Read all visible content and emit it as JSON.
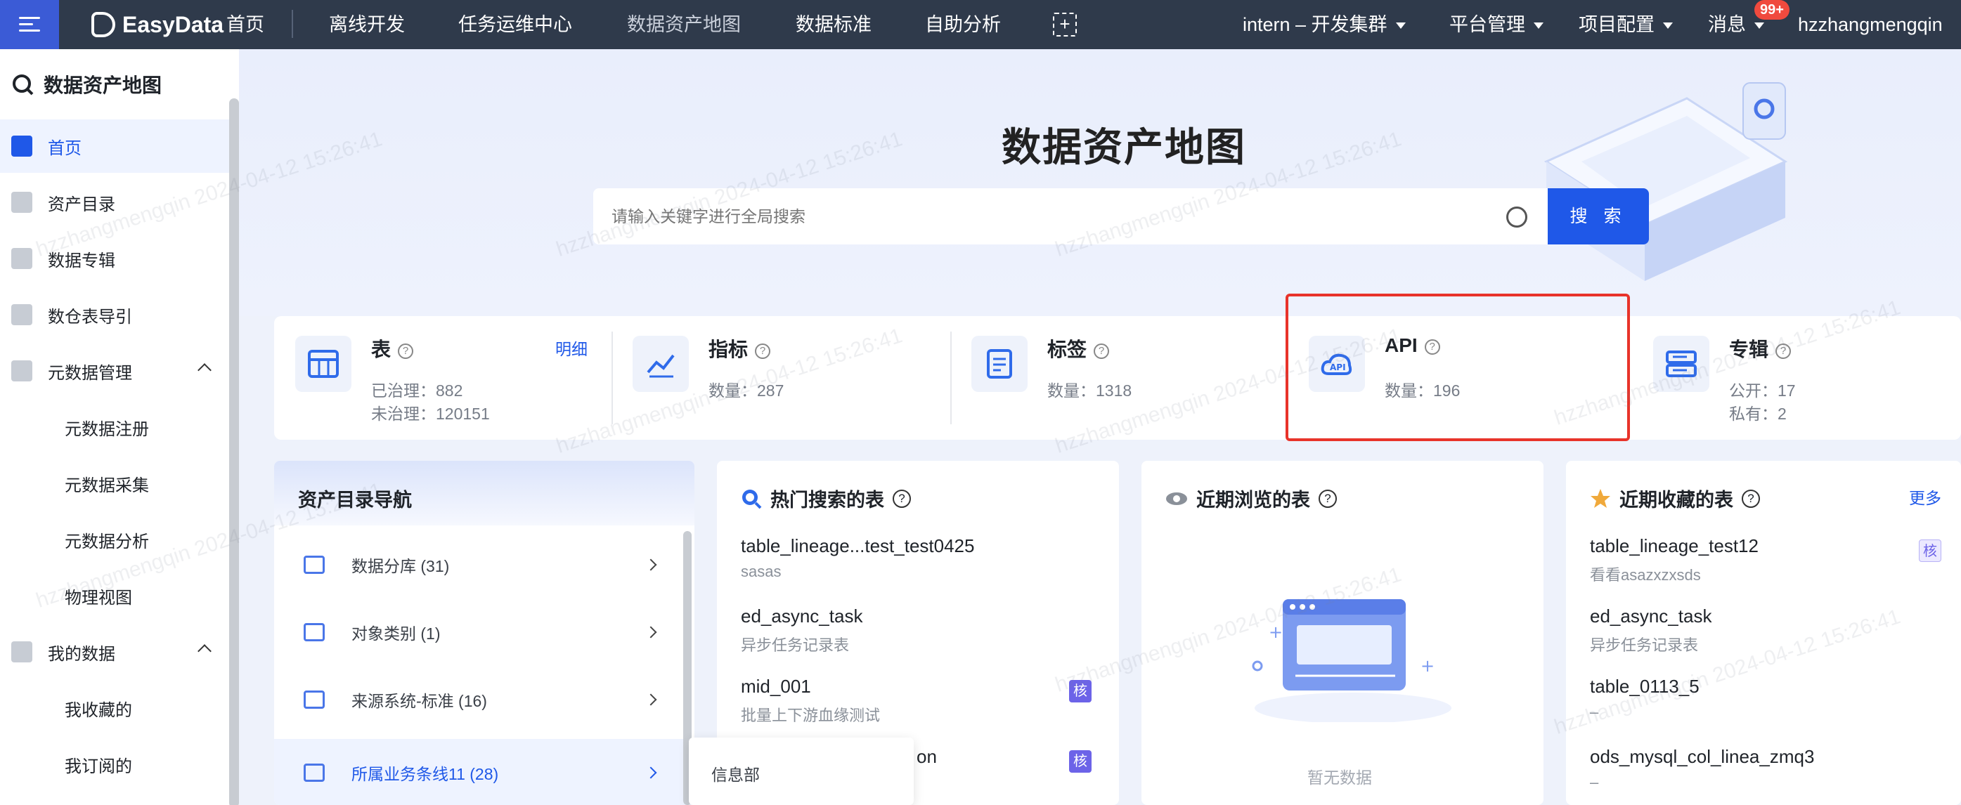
{
  "topbar": {
    "brand": "EasyData",
    "nav": [
      "首页",
      "离线开发",
      "任务运维中心",
      "数据资产地图",
      "数据标准",
      "自助分析"
    ],
    "cluster": "intern – 开发集群",
    "platform": "平台管理",
    "project": "项目配置",
    "messages": "消息",
    "badge": "99+",
    "user": "hzzhangmengqin"
  },
  "sidebar": {
    "title": "数据资产地图",
    "items": [
      {
        "label": "首页"
      },
      {
        "label": "资产目录"
      },
      {
        "label": "数据专辑"
      },
      {
        "label": "数仓表导引"
      },
      {
        "label": "元数据管理"
      },
      {
        "label": "元数据注册"
      },
      {
        "label": "元数据采集"
      },
      {
        "label": "元数据分析"
      },
      {
        "label": "物理视图"
      },
      {
        "label": "我的数据"
      },
      {
        "label": "我收藏的"
      },
      {
        "label": "我订阅的"
      }
    ]
  },
  "hero": {
    "title": "数据资产地图",
    "search_placeholder": "请输入关键字进行全局搜索",
    "search_button": "搜 索"
  },
  "stats": [
    {
      "name": "表",
      "line1": "已治理：882",
      "line2": "未治理：120151",
      "more": "明细"
    },
    {
      "name": "指标",
      "line1": "数量：287"
    },
    {
      "name": "标签",
      "line1": "数量：1318"
    },
    {
      "name": "API",
      "line1": "数量：196"
    },
    {
      "name": "专辑",
      "line1": "公开：17",
      "line2": "私有：2"
    }
  ],
  "nav_panel": {
    "title": "资产目录导航",
    "rows": [
      "数据分库 (31)",
      "对象类别 (1)",
      "来源系统-标准 (16)",
      "所属业务条线11 (28)"
    ],
    "dropdown": "信息部"
  },
  "hot": {
    "title": "热门搜索的表",
    "items": [
      {
        "t": "table_lineage...test_test0425",
        "d": "sasas"
      },
      {
        "t": "ed_async_task",
        "d": "异步任务记录表"
      },
      {
        "t": "mid_001",
        "d": "批量上下游血缘测试"
      },
      {
        "t": "on",
        "d": ""
      }
    ],
    "tag": "核"
  },
  "recent": {
    "title": "近期浏览的表",
    "empty": "暂无数据"
  },
  "favorites": {
    "title": "近期收藏的表",
    "more": "更多",
    "items": [
      {
        "t": "table_lineage_test12",
        "d": "看看asazxzxsds"
      },
      {
        "t": "ed_async_task",
        "d": "异步任务记录表"
      },
      {
        "t": "table_0113_5",
        "d": "–"
      },
      {
        "t": "ods_mysql_col_linea_zmq3",
        "d": "–"
      }
    ],
    "tag": "核"
  },
  "watermark": "hzzhangmengqin 2024-04-12 15:26:41"
}
